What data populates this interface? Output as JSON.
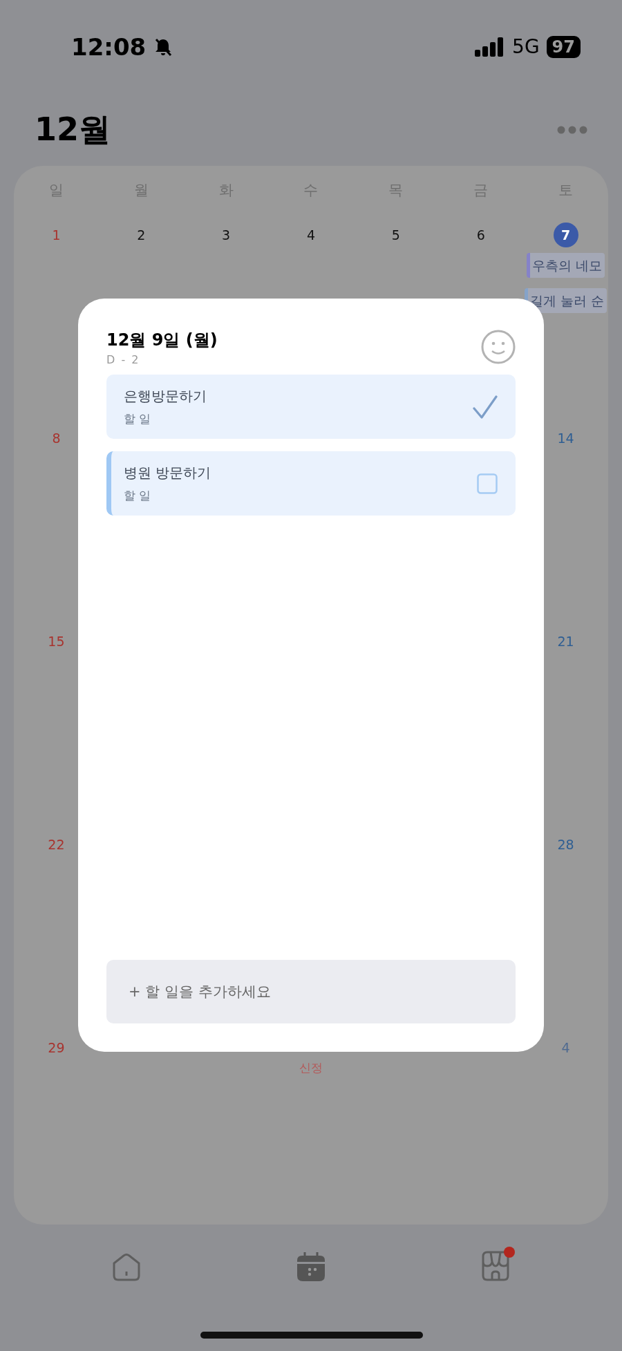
{
  "status_bar": {
    "time": "12:08",
    "network": "5G",
    "battery": "97"
  },
  "header": {
    "title": "12월"
  },
  "calendar": {
    "weekdays": [
      "일",
      "월",
      "화",
      "수",
      "목",
      "금",
      "토"
    ],
    "weeks": [
      {
        "sun": {
          "date": "1",
          "kind": "sun",
          "selected": false
        },
        "mon": {
          "date": "2",
          "kind": "weekday",
          "selected": false
        },
        "tue": {
          "date": "3",
          "kind": "weekday",
          "selected": false
        },
        "wed": {
          "date": "4",
          "kind": "weekday",
          "selected": false
        },
        "thu": {
          "date": "5",
          "kind": "weekday",
          "selected": false
        },
        "fri": {
          "date": "6",
          "kind": "weekday",
          "selected": false
        },
        "sat": {
          "date": "7",
          "kind": "sat",
          "selected": true,
          "events": [
            {
              "title": "우측의 네모",
              "kind": "event",
              "color": "#8582c9"
            },
            {
              "title": "길게 눌러 순",
              "kind": "event",
              "color": "#85a3c9"
            }
          ]
        }
      },
      {
        "sun": {
          "date": "8",
          "kind": "sun",
          "selected": false
        },
        "sat": {
          "date": "14",
          "kind": "sat",
          "selected": false
        }
      },
      {
        "sun": {
          "date": "15",
          "kind": "sun",
          "selected": false
        },
        "sat": {
          "date": "21",
          "kind": "sat",
          "selected": false
        }
      },
      {
        "sun": {
          "date": "22",
          "kind": "sun",
          "selected": false
        },
        "sat": {
          "date": "28",
          "kind": "sat",
          "selected": false
        }
      },
      {
        "sun": {
          "date": "29",
          "kind": "sun",
          "selected": false
        },
        "wed": {
          "events": [
            {
              "title": "신정",
              "kind": "holiday",
              "color": "#b35a5a"
            }
          ]
        },
        "sat": {
          "date": "4",
          "kind": "other_month",
          "selected": false
        }
      }
    ]
  },
  "dialog": {
    "title": "12월 9일 (월)",
    "subtitle": "D - 2",
    "tasks": [
      {
        "title": "은행방문하기",
        "category": "할 일",
        "done": true,
        "selected": false
      },
      {
        "title": "병원 방문하기",
        "category": "할 일",
        "done": false,
        "selected": true
      }
    ],
    "add_button": "+ 할 일을 추가하세요"
  },
  "tab_bar": {
    "items": [
      {
        "kind": "home",
        "badge": false
      },
      {
        "kind": "calendar",
        "badge": false
      },
      {
        "kind": "store",
        "badge": true
      }
    ]
  }
}
